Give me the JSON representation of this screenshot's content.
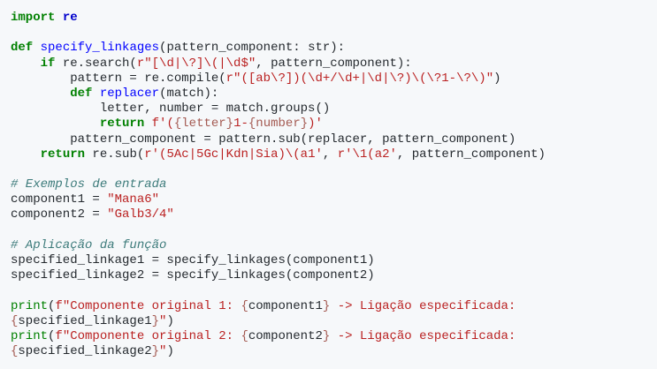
{
  "code": {
    "language": "python",
    "lines": [
      [
        {
          "t": "import",
          "c": "kw"
        },
        {
          "t": " ",
          "c": "plain"
        },
        {
          "t": "re",
          "c": "kw2"
        }
      ],
      [],
      [
        {
          "t": "def",
          "c": "kw"
        },
        {
          "t": " ",
          "c": "plain"
        },
        {
          "t": "specify_linkages",
          "c": "fn"
        },
        {
          "t": "(pattern_component: str):",
          "c": "plain"
        }
      ],
      [
        {
          "t": "    ",
          "c": "plain"
        },
        {
          "t": "if",
          "c": "kw"
        },
        {
          "t": " re.search(",
          "c": "plain"
        },
        {
          "t": "r\"[\\d|\\?]\\(|\\d$\"",
          "c": "str"
        },
        {
          "t": ", pattern_component):",
          "c": "plain"
        }
      ],
      [
        {
          "t": "        pattern = re.compile(",
          "c": "plain"
        },
        {
          "t": "r\"([ab\\?])(\\d+/\\d+|\\d|\\?)\\(\\?1-\\?\\)\"",
          "c": "str"
        },
        {
          "t": ")",
          "c": "plain"
        }
      ],
      [
        {
          "t": "        ",
          "c": "plain"
        },
        {
          "t": "def",
          "c": "kw"
        },
        {
          "t": " ",
          "c": "plain"
        },
        {
          "t": "replacer",
          "c": "fn"
        },
        {
          "t": "(match):",
          "c": "plain"
        }
      ],
      [
        {
          "t": "            letter, number = match.groups()",
          "c": "plain"
        }
      ],
      [
        {
          "t": "            ",
          "c": "plain"
        },
        {
          "t": "return",
          "c": "kw"
        },
        {
          "t": " ",
          "c": "plain"
        },
        {
          "t": "f'(",
          "c": "str"
        },
        {
          "t": "{letter}",
          "c": "interp"
        },
        {
          "t": "1-",
          "c": "str"
        },
        {
          "t": "{number}",
          "c": "interp"
        },
        {
          "t": ")'",
          "c": "str"
        }
      ],
      [
        {
          "t": "        pattern_component = pattern.sub(replacer, pattern_component)",
          "c": "plain"
        }
      ],
      [
        {
          "t": "    ",
          "c": "plain"
        },
        {
          "t": "return",
          "c": "kw"
        },
        {
          "t": " re.sub(",
          "c": "plain"
        },
        {
          "t": "r'(5Ac|5Gc|Kdn|Sia)\\(a1'",
          "c": "str"
        },
        {
          "t": ", ",
          "c": "plain"
        },
        {
          "t": "r'\\1(a2'",
          "c": "str"
        },
        {
          "t": ", pattern_component)",
          "c": "plain"
        }
      ],
      [],
      [
        {
          "t": "# Exemplos de entrada",
          "c": "cm"
        }
      ],
      [
        {
          "t": "component1 = ",
          "c": "plain"
        },
        {
          "t": "\"Mana6\"",
          "c": "str"
        }
      ],
      [
        {
          "t": "component2 = ",
          "c": "plain"
        },
        {
          "t": "\"Galb3/4\"",
          "c": "str"
        }
      ],
      [],
      [
        {
          "t": "# Aplicação da função",
          "c": "cm"
        }
      ],
      [
        {
          "t": "specified_linkage1 = specify_linkages(component1)",
          "c": "plain"
        }
      ],
      [
        {
          "t": "specified_linkage2 = specify_linkages(component2)",
          "c": "plain"
        }
      ],
      [],
      [
        {
          "t": "print",
          "c": "bi"
        },
        {
          "t": "(",
          "c": "plain"
        },
        {
          "t": "f\"Componente original 1: ",
          "c": "str"
        },
        {
          "t": "{",
          "c": "interp"
        },
        {
          "t": "component1",
          "c": "plain"
        },
        {
          "t": "}",
          "c": "interp"
        },
        {
          "t": " -> Ligação especificada:",
          "c": "str"
        }
      ],
      [
        {
          "t": "{",
          "c": "interp"
        },
        {
          "t": "specified_linkage1",
          "c": "plain"
        },
        {
          "t": "}",
          "c": "interp"
        },
        {
          "t": "\"",
          "c": "str"
        },
        {
          "t": ")",
          "c": "plain"
        }
      ],
      [
        {
          "t": "print",
          "c": "bi"
        },
        {
          "t": "(",
          "c": "plain"
        },
        {
          "t": "f\"Componente original 2: ",
          "c": "str"
        },
        {
          "t": "{",
          "c": "interp"
        },
        {
          "t": "component2",
          "c": "plain"
        },
        {
          "t": "}",
          "c": "interp"
        },
        {
          "t": " -> Ligação especificada:",
          "c": "str"
        }
      ],
      [
        {
          "t": "{",
          "c": "interp"
        },
        {
          "t": "specified_linkage2",
          "c": "plain"
        },
        {
          "t": "}",
          "c": "interp"
        },
        {
          "t": "\"",
          "c": "str"
        },
        {
          "t": ")",
          "c": "plain"
        }
      ]
    ]
  },
  "colors": {
    "background": "#f6f8fa",
    "keyword": "#008000",
    "module": "#0000cc",
    "function_name": "#0000ff",
    "string": "#ba2121",
    "comment": "#3d7b7b",
    "text": "#24292e"
  }
}
